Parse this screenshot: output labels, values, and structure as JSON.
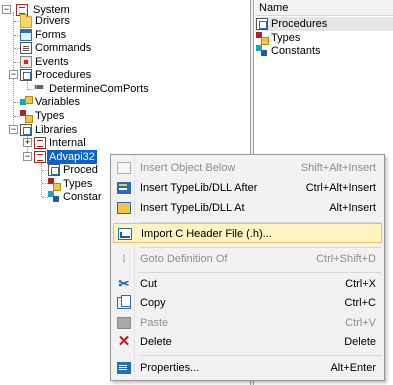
{
  "tree": {
    "nodes": [
      {
        "label": "System",
        "icon": "book-icon"
      },
      {
        "label": "Drivers",
        "icon": "folder-icon"
      },
      {
        "label": "Forms",
        "icon": "form-icon"
      },
      {
        "label": "Commands",
        "icon": "command-icon"
      },
      {
        "label": "Events",
        "icon": "event-icon"
      },
      {
        "label": "Procedures",
        "icon": "procedure-icon"
      },
      {
        "label": "DetermineComPorts",
        "icon": "function-icon"
      },
      {
        "label": "Variables",
        "icon": "variable-icon"
      },
      {
        "label": "Types",
        "icon": "type-icon"
      },
      {
        "label": "Libraries",
        "icon": "procedure-icon"
      },
      {
        "label": "Internal",
        "icon": "book-icon"
      },
      {
        "label": "Advapi32",
        "icon": "book-icon"
      },
      {
        "label": "Proced",
        "icon": "procedure-icon"
      },
      {
        "label": "Types",
        "icon": "type-icon"
      },
      {
        "label": "Constar",
        "icon": "constant-icon"
      }
    ],
    "toggle_minus": "−",
    "toggle_plus": "+"
  },
  "right_pane": {
    "column_header": "Name",
    "rows": [
      {
        "label": "Procedures",
        "icon": "procedure-icon"
      },
      {
        "label": "Types",
        "icon": "type-icon"
      },
      {
        "label": "Constants",
        "icon": "constant-icon"
      }
    ]
  },
  "context_menu": {
    "items": [
      {
        "label": "Insert Object Below",
        "shortcut": "Shift+Alt+Insert",
        "icon": "insert-object-icon",
        "enabled": false
      },
      {
        "label": "Insert TypeLib/DLL After",
        "shortcut": "Ctrl+Alt+Insert",
        "icon": "typelib-after-icon",
        "enabled": true
      },
      {
        "label": "Insert TypeLib/DLL At",
        "shortcut": "Alt+Insert",
        "icon": "typelib-at-icon",
        "enabled": true
      },
      {
        "label": "Import C Header File (.h)...",
        "shortcut": "",
        "icon": "import-header-icon",
        "enabled": true,
        "highlighted": true
      },
      {
        "label": "Goto Definition Of",
        "shortcut": "Ctrl+Shift+D",
        "icon": "goto-definition-icon",
        "enabled": false
      },
      {
        "label": "Cut",
        "shortcut": "Ctrl+X",
        "icon": "cut-icon",
        "enabled": true
      },
      {
        "label": "Copy",
        "shortcut": "Ctrl+C",
        "icon": "copy-icon",
        "enabled": true
      },
      {
        "label": "Paste",
        "shortcut": "Ctrl+V",
        "icon": "paste-icon",
        "enabled": false
      },
      {
        "label": "Delete",
        "shortcut": "Delete",
        "icon": "delete-icon",
        "enabled": true
      },
      {
        "label": "Properties...",
        "shortcut": "Alt+Enter",
        "icon": "properties-icon",
        "enabled": true
      }
    ]
  },
  "colors": {
    "selection": "#0a64c8",
    "menu_highlight": "#fff3c0",
    "menu_highlight_border": "#e5c365"
  }
}
